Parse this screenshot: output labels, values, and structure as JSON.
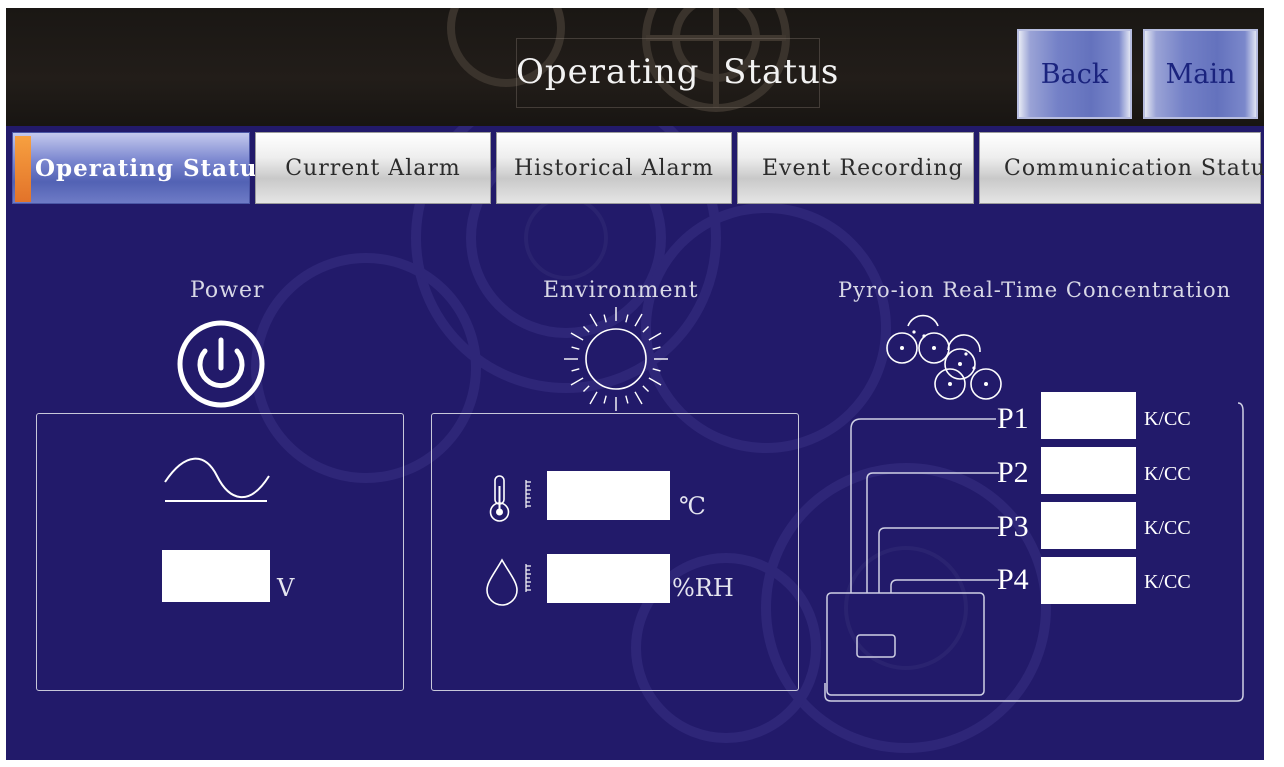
{
  "header": {
    "title": "Operating  Status",
    "back_label": "Back",
    "main_label": "Main"
  },
  "tabs": [
    {
      "label": "Operating Status",
      "active": true
    },
    {
      "label": "Current Alarm",
      "active": false
    },
    {
      "label": "Historical Alarm",
      "active": false
    },
    {
      "label": "Event Recording",
      "active": false
    },
    {
      "label": "Communication Status",
      "active": false
    }
  ],
  "power": {
    "title": "Power",
    "voltage_value": "",
    "voltage_unit": "V",
    "icons": [
      "power-icon",
      "sine-wave-icon"
    ]
  },
  "environment": {
    "title": "Environment",
    "temperature_value": "",
    "temperature_unit": "℃",
    "humidity_value": "",
    "humidity_unit": "%RH",
    "icons": [
      "sun-icon",
      "thermometer-icon",
      "water-drop-icon"
    ]
  },
  "pyro": {
    "title": "Pyro-ion Real-Time Concentration",
    "probes": [
      {
        "label": "P1",
        "value": "",
        "unit": "K/CC"
      },
      {
        "label": "P2",
        "value": "",
        "unit": "K/CC"
      },
      {
        "label": "P3",
        "value": "",
        "unit": "K/CC"
      },
      {
        "label": "P4",
        "value": "",
        "unit": "K/CC"
      }
    ],
    "icons": [
      "ion-cluster-icon",
      "sensor-device-icon"
    ]
  },
  "colors": {
    "background": "#221a6a",
    "header": "#1a1714",
    "active_tab": "#5262b4",
    "tab_marker": "#e2732a",
    "button_text": "#1a237e"
  }
}
